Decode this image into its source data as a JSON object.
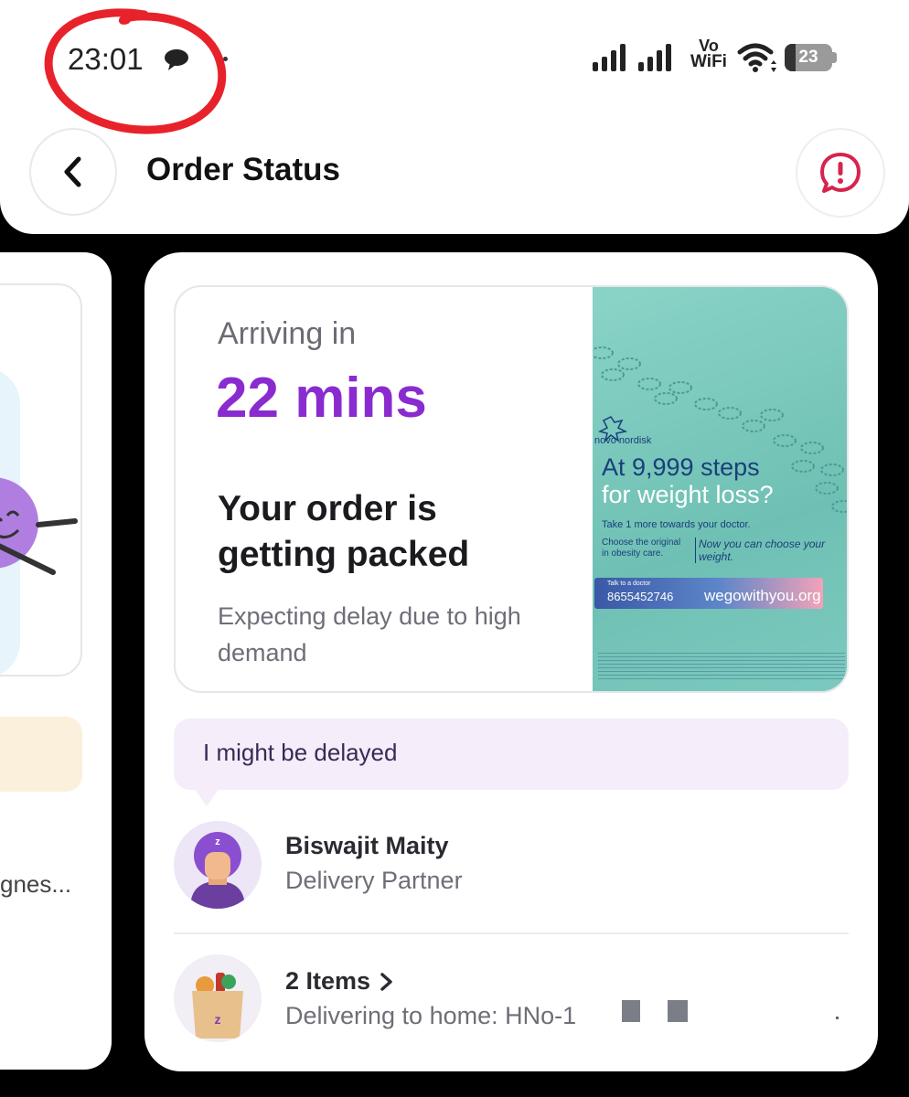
{
  "status_bar": {
    "time": "23:01",
    "wifi_calling_top": "Vo",
    "wifi_calling_bottom": "WiFi",
    "battery_level": "23",
    "battery_fraction": 0.23
  },
  "header": {
    "title": "Order Status"
  },
  "left_card": {
    "text": "gnes..."
  },
  "order_status": {
    "arriving_label": "Arriving in",
    "eta": "22 mins",
    "status_heading": "Your order is getting packed",
    "delay_note": "Expecting delay due to high demand"
  },
  "ad": {
    "brand": "novo nordisk",
    "headline": "At 9,999 steps",
    "subheadline": "for weight loss?",
    "tagline": "Take 1 more towards your doctor.",
    "original": "Choose the original in obesity care.",
    "choose": "Now you can choose your weight.",
    "cta_small": "Talk to a doctor",
    "phone": "8655452746",
    "site": "wegowithyou.org"
  },
  "delivery": {
    "delay_message": "I might be delayed",
    "partner_name": "Biswajit Maity",
    "partner_role": "Delivery Partner",
    "items_label": "2 Items",
    "address": "Delivering to home: HNo-1"
  },
  "colors": {
    "accent_purple": "#8a2bd0",
    "alert_red": "#d6244f",
    "annotation_red": "#e8222a"
  }
}
